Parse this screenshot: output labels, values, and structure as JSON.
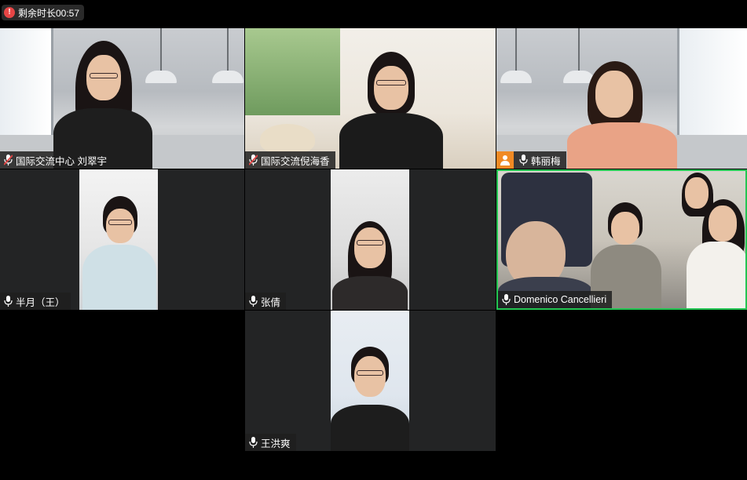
{
  "timer": {
    "icon": "alert-icon",
    "label": "剩余时长00:57",
    "icon_color": "#e64545"
  },
  "participants": [
    {
      "name": "国际交流中心 刘翠宇",
      "mic": "mic-muted-icon",
      "background": "room"
    },
    {
      "name": "国际交流倪海香",
      "mic": "mic-muted-icon",
      "background": "garden"
    },
    {
      "name": "韩丽梅",
      "mic": "mic-icon",
      "background": "room",
      "has_avatar_flag": true
    },
    {
      "name": "半月（王）",
      "mic": "mic-icon",
      "background": "video"
    },
    {
      "name": "张倩",
      "mic": "mic-icon",
      "background": "video"
    },
    {
      "name": "Domenico Cancellieri",
      "mic": "mic-icon",
      "background": "group",
      "active_speaker": true
    },
    {
      "name": "王洪爽",
      "mic": "mic-icon",
      "background": "video"
    }
  ],
  "colors": {
    "active_speaker_border": "#23c552",
    "tile_bg": "#232425",
    "avatar_flag": "#f08a24"
  }
}
